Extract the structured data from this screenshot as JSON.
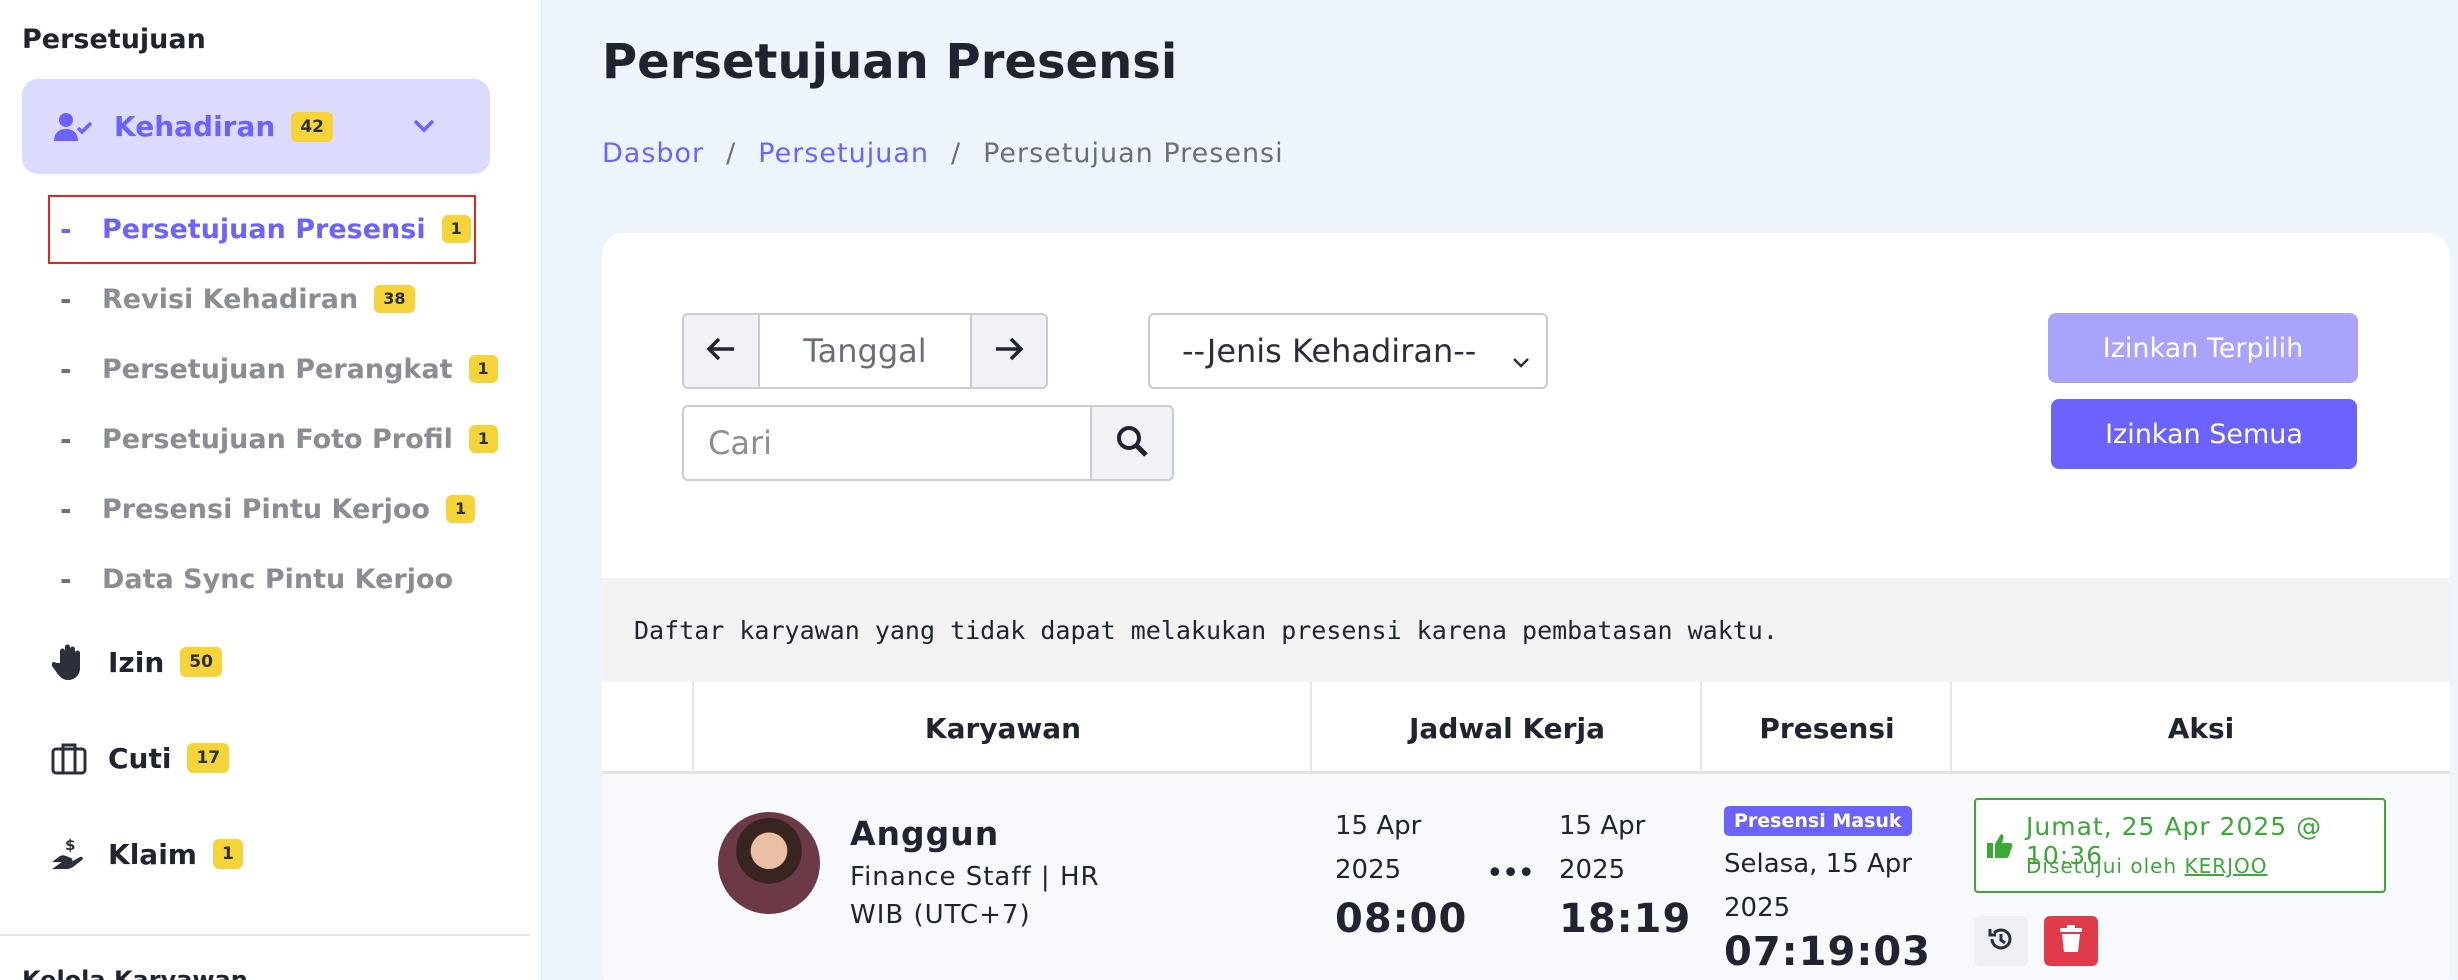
{
  "sidebar": {
    "heading": "Persetujuan",
    "parent": {
      "label": "Kehadiran",
      "badge": "42",
      "icon": "user-check-icon"
    },
    "subitems": [
      {
        "label": "Persetujuan Presensi",
        "badge": "1",
        "active": true
      },
      {
        "label": "Revisi Kehadiran",
        "badge": "38"
      },
      {
        "label": "Persetujuan Perangkat",
        "badge": "1"
      },
      {
        "label": "Persetujuan Foto Profil",
        "badge": "1"
      },
      {
        "label": "Presensi Pintu Kerjoo",
        "badge": "1"
      },
      {
        "label": "Data Sync Pintu Kerjoo"
      }
    ],
    "items": [
      {
        "label": "Izin",
        "badge": "50",
        "icon": "hand-icon"
      },
      {
        "label": "Cuti",
        "badge": "17",
        "icon": "briefcase-icon"
      },
      {
        "label": "Klaim",
        "badge": "1",
        "icon": "hand-money-icon"
      }
    ],
    "dash": "-",
    "cut_heading": "Kelola Karyawan"
  },
  "page": {
    "title": "Persetujuan Presensi",
    "breadcrumb": [
      {
        "label": "Dasbor"
      },
      {
        "label": "Persetujuan"
      },
      {
        "label": "Persetujuan Presensi"
      }
    ],
    "breadcrumb_sep": "/"
  },
  "filters": {
    "date_placeholder": "Tanggal",
    "type_select": "--Jenis Kehadiran--",
    "search_placeholder": "Cari"
  },
  "buttons": {
    "approve_selected": "Izinkan Terpilih",
    "approve_all": "Izinkan Semua"
  },
  "notice": "Daftar karyawan yang tidak dapat melakukan presensi karena pembatasan waktu.",
  "table": {
    "headers": [
      "Karyawan",
      "Jadwal Kerja",
      "Presensi",
      "Aksi"
    ],
    "rows": [
      {
        "employee": {
          "name": "Anggun",
          "role": "Finance Staff | HR",
          "timezone": "WIB (UTC+7)"
        },
        "schedule": {
          "start_date": "15 Apr 2025",
          "start_time": "08:00",
          "end_date": "15 Apr 2025",
          "end_time": "18:19",
          "separator": "•••"
        },
        "presence": {
          "badge": "Presensi Masuk",
          "date": "Selasa, 15 Apr 2025",
          "time": "07:19:03"
        },
        "status": {
          "date": "Jumat, 25 Apr 2025 @ 10:36",
          "by_prefix": "Disetujui oleh",
          "by_user": "KERJOO"
        }
      }
    ]
  },
  "colors": {
    "accent": "#6c63ff",
    "badge": "#f6d339",
    "success": "#3aa935",
    "danger": "#e13a4b"
  }
}
